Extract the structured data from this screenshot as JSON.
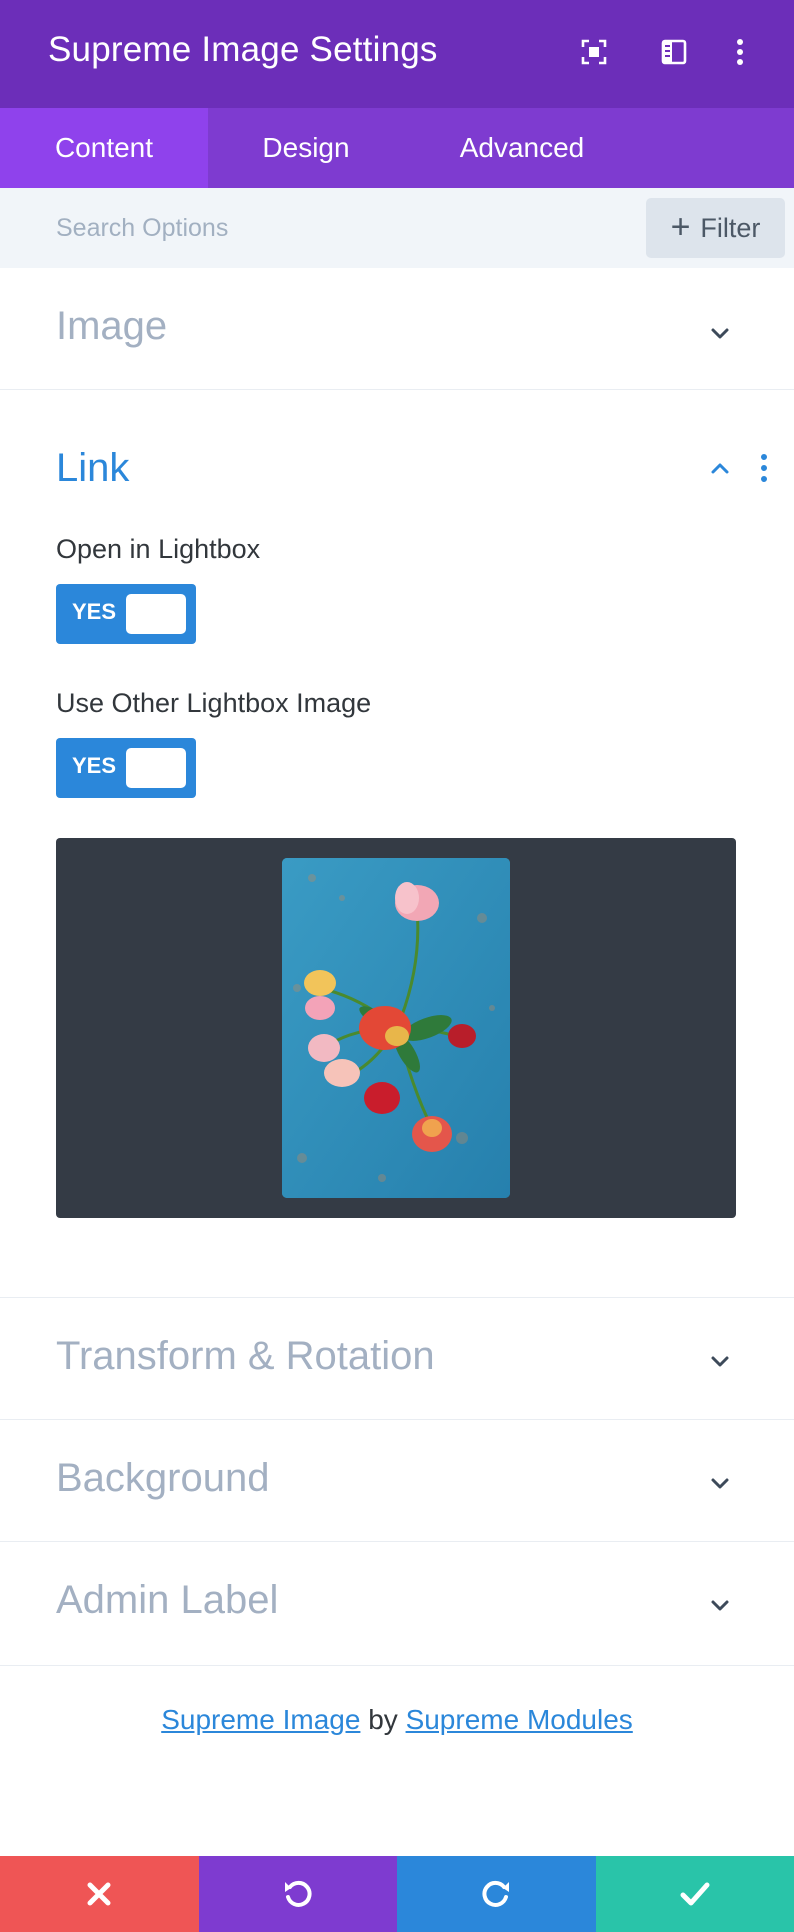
{
  "header": {
    "title": "Supreme Image Settings",
    "icons": [
      "expand-icon",
      "sidebar-layout-icon",
      "more-vertical-icon"
    ]
  },
  "tabs": [
    {
      "label": "Content",
      "active": true
    },
    {
      "label": "Design",
      "active": false
    },
    {
      "label": "Advanced",
      "active": false
    }
  ],
  "search": {
    "placeholder": "Search Options",
    "value": "",
    "filter_label": "Filter"
  },
  "sections": {
    "image": {
      "title": "Image",
      "expanded": false
    },
    "link": {
      "title": "Link",
      "expanded": true,
      "fields": {
        "open_lightbox": {
          "label": "Open in Lightbox",
          "toggle": "YES"
        },
        "other_image": {
          "label": "Use Other Lightbox Image",
          "toggle": "YES"
        }
      }
    },
    "transform": {
      "title": "Transform & Rotation",
      "expanded": false
    },
    "background": {
      "title": "Background",
      "expanded": false
    },
    "admin_label": {
      "title": "Admin Label",
      "expanded": false
    }
  },
  "credit": {
    "module_link": "Supreme Image",
    "by": "by",
    "author_link": "Supreme Modules"
  },
  "footer": {
    "buttons": [
      {
        "name": "discard",
        "icon": "close-icon",
        "color": "#ef5555"
      },
      {
        "name": "undo",
        "icon": "undo-icon",
        "color": "#7e3bd0"
      },
      {
        "name": "redo",
        "icon": "redo-icon",
        "color": "#2b87da"
      },
      {
        "name": "save",
        "icon": "check-icon",
        "color": "#29c4a9"
      }
    ]
  },
  "colors": {
    "header": "#6c2eb9",
    "tabs": "#7e3bd0",
    "active_tab": "#8f42ec",
    "accent_blue": "#2b87da",
    "muted_title": "#a3b0c2"
  }
}
